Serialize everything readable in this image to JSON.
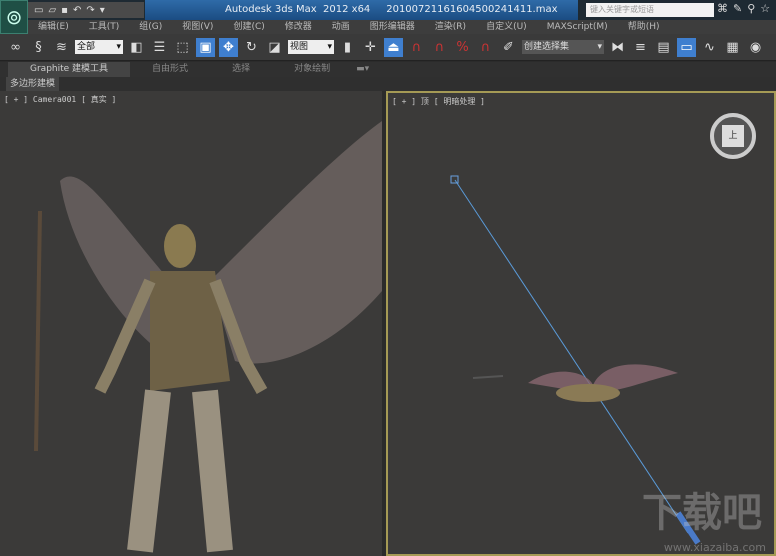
{
  "app": {
    "title": "Autodesk 3ds Max  2012 x64",
    "file": "20100721161604500241411.max"
  },
  "search": {
    "placeholder": "键入关键字或短语"
  },
  "menu": [
    "编辑(E)",
    "工具(T)",
    "组(G)",
    "视图(V)",
    "创建(C)",
    "修改器",
    "动画",
    "图形编辑器",
    "渲染(R)",
    "自定义(U)",
    "MAXScript(M)",
    "帮助(H)"
  ],
  "toolbar": {
    "selection_filter": "全部",
    "ref_coord": "视图",
    "named_selection": "创建选择集"
  },
  "ribbon": {
    "tabs": [
      "Graphite 建模工具",
      "自由形式",
      "选择",
      "对象绘制"
    ],
    "panel": "多边形建模"
  },
  "viewports": {
    "left": "[ + ] Camera001 [ 真实 ]",
    "right": "[ + ] 顶 [ 明暗处理 ]"
  },
  "viewcube": {
    "face": "上"
  },
  "watermark": {
    "logo": "下载吧",
    "url": "www.xiazaiba.com"
  }
}
